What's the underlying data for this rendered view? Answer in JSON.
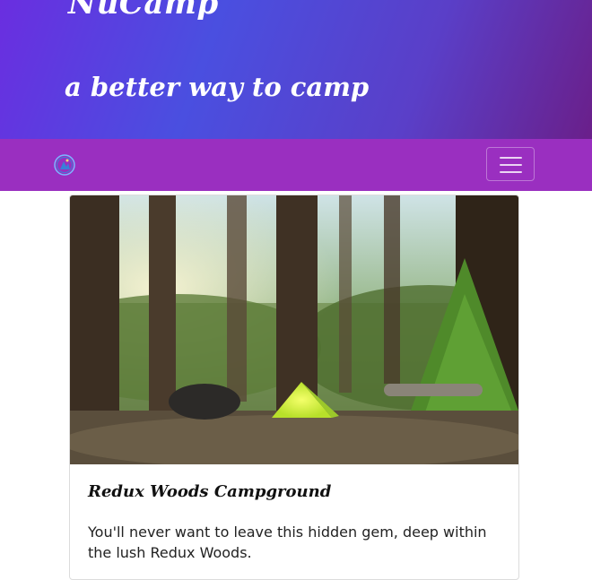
{
  "header": {
    "title": "NuCamp",
    "tagline": "a better way to camp"
  },
  "navbar": {
    "logo_icon": "nucamp-logo-icon",
    "toggler_icon": "hamburger-menu-icon"
  },
  "card": {
    "image": "campsite-photo-tent-in-forest",
    "title": "Redux Woods Campground",
    "text": "You'll never want to leave this hidden gem, deep within the lush Redux Woods."
  },
  "colors": {
    "jumbotron_start": "#6a2ee0",
    "jumbotron_end": "#6a1f8a",
    "navbar": "#9a2fc0"
  }
}
